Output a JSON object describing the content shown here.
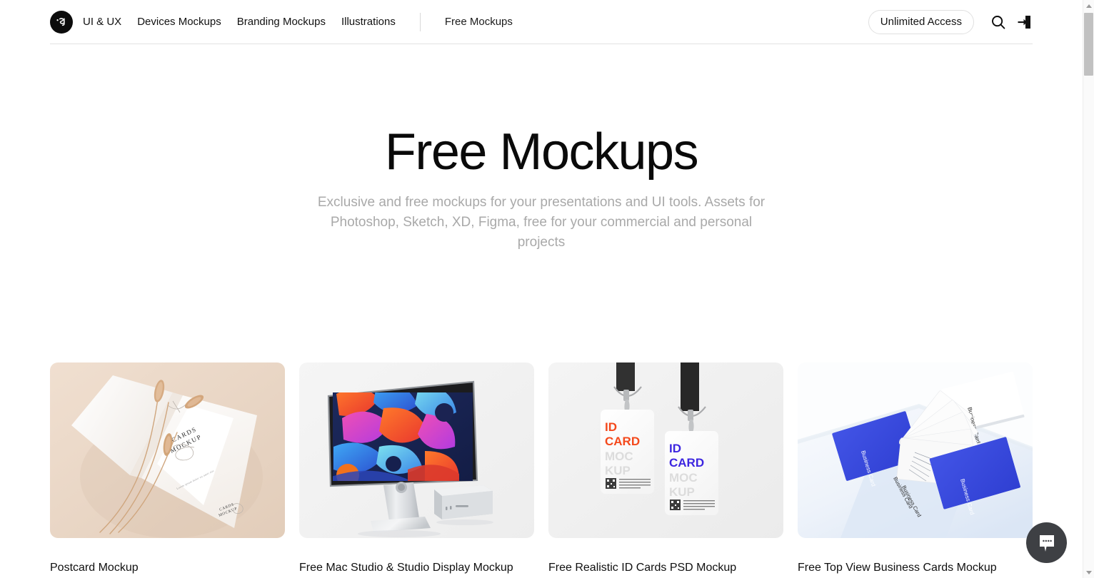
{
  "header": {
    "logo_icon": "brand-logo-js-circle",
    "nav_items": [
      {
        "label": "UI & UX"
      },
      {
        "label": "Devices Mockups"
      },
      {
        "label": "Branding Mockups"
      },
      {
        "label": "Illustrations"
      }
    ],
    "active_nav": {
      "label": "Free Mockups"
    },
    "unlimited_button": "Unlimited Access",
    "search_icon": "search-icon",
    "login_icon": "sign-in-arrow-icon"
  },
  "hero": {
    "title": "Free Mockups",
    "subtitle": "Exclusive and free mockups for your presentations and UI tools. Assets for Photoshop, Sketch, XD, Figma, free for your commercial and personal projects"
  },
  "grid": {
    "cards": [
      {
        "title": "Postcard Mockup",
        "thumb_name": "postcard-mockup-thumbnail",
        "bg": "#ead9c9",
        "labels": {
          "line1": "CARDS",
          "line2": "MOCKUP",
          "corner1": "CARDS",
          "corner2": "MOCKUP"
        }
      },
      {
        "title": "Free Mac Studio & Studio Display Mockup",
        "thumb_name": "mac-studio-display-mockup-thumbnail",
        "bg": "#f2f2f2"
      },
      {
        "title": "Free Realistic ID Cards PSD Mockup",
        "thumb_name": "id-cards-mockup-thumbnail",
        "bg": "#f0f0f0",
        "labels": {
          "card1_top": "ID",
          "card1_mid": "CARD",
          "card1_ghost1": "MOC",
          "card1_ghost2": "KUP",
          "card2_top": "ID",
          "card2_mid": "CARD",
          "card2_ghost1": "MOC",
          "card2_ghost2": "KUP"
        },
        "accent1": "#f4491c",
        "accent2": "#3d26e0"
      },
      {
        "title": "Free Top View Business Cards Mockup",
        "thumb_name": "business-cards-mockup-thumbnail",
        "bg": "#f7f9fc",
        "labels": {
          "card_text": "Business Card"
        },
        "accent": "#3b4ddb"
      }
    ]
  },
  "chat": {
    "icon": "chat-bubble-icon"
  },
  "scrollbar": {
    "up_icon": "scroll-up-arrow-icon",
    "down_icon": "scroll-down-arrow-icon"
  },
  "colors": {
    "page_bg": "#ffffff",
    "text": "#0a0a0a",
    "muted": "#a9a9a9",
    "border": "#e2e2e2",
    "chat_bg": "#3e4044"
  }
}
